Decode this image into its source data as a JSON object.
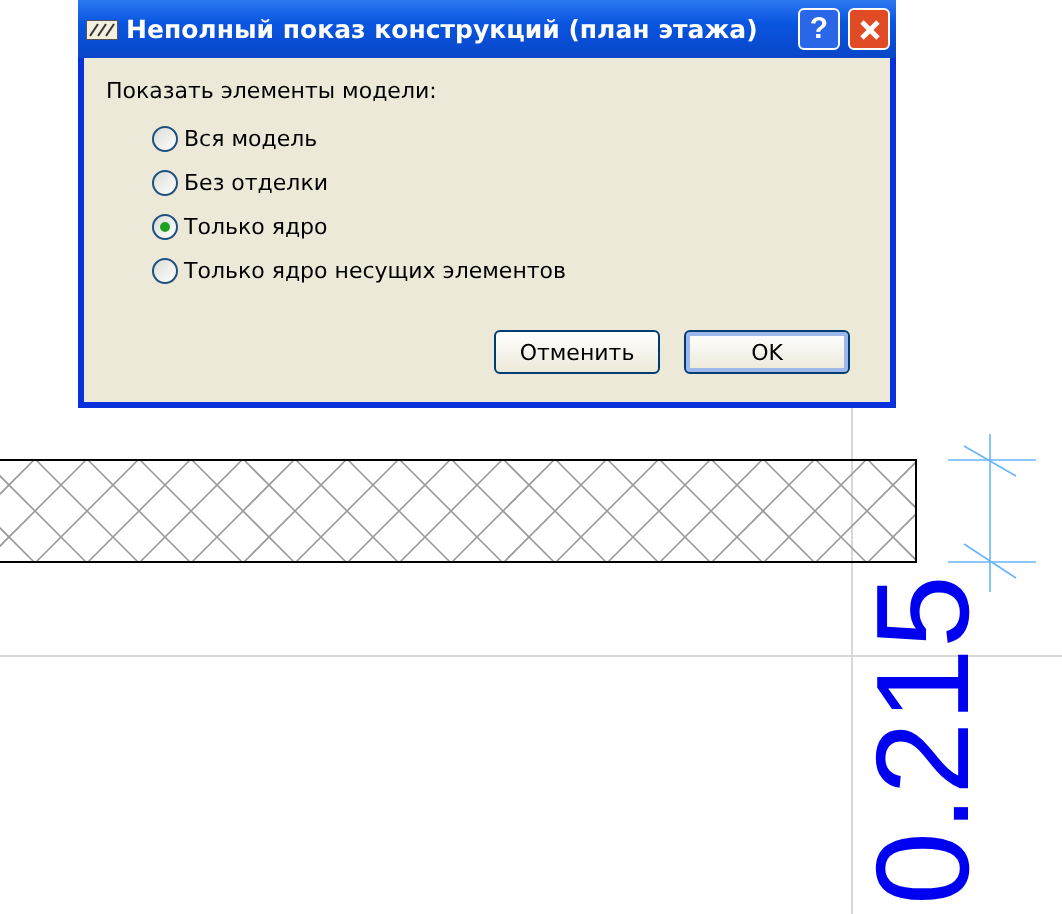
{
  "window": {
    "title": "Неполный показ конструкций (план этажа)",
    "help_button": "?"
  },
  "group_label": "Показать элементы модели:",
  "options": [
    {
      "label": "Вся модель",
      "selected": false
    },
    {
      "label": "Без отделки",
      "selected": false
    },
    {
      "label": "Только ядро",
      "selected": true
    },
    {
      "label": "Только ядро несущих элементов",
      "selected": false
    }
  ],
  "buttons": [
    {
      "label": "Отменить",
      "default": false
    },
    {
      "label": "OK",
      "default": true
    }
  ],
  "drawing": {
    "dimension": "0.215"
  }
}
